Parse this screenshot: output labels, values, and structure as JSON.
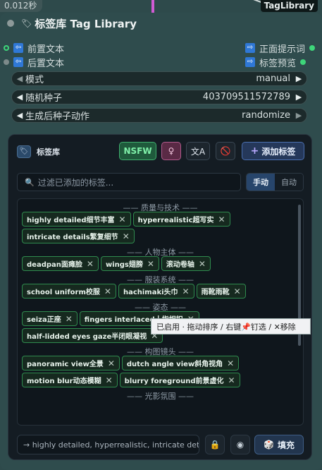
{
  "timer": "0.012秒",
  "top_tag": "TagLibrary",
  "node": {
    "title": "标签库 Tag Library"
  },
  "inputs": [
    {
      "label": "前置文本"
    },
    {
      "label": "后置文本"
    }
  ],
  "outputs": [
    {
      "label": "正面提示词"
    },
    {
      "label": "标签预览"
    }
  ],
  "widgets": [
    {
      "label": "模式",
      "value": "manual"
    },
    {
      "label": "随机种子",
      "value": "403709511572789"
    },
    {
      "label": "生成后种子动作",
      "value": "randomize"
    }
  ],
  "panel": {
    "title": "标签库",
    "nsfw_label": "NSFW",
    "gender_icon": "♀",
    "translate_label": "文A",
    "add_label": "添加标签",
    "search_placeholder": "过滤已添加的标签...",
    "mode_manual": "手动",
    "mode_auto": "自动",
    "categories": [
      {
        "name": "—— 质量与技术 ——",
        "tags": [
          "highly detailed细节丰富",
          "hyperrealistic超写实",
          "intricate details繁复细节"
        ]
      },
      {
        "name": "—— 人物主体 ——",
        "tags": [
          "deadpan面瘫脸",
          "wings翅膀",
          "滚动卷轴"
        ]
      },
      {
        "name": "—— 服装系统 ——",
        "tags": [
          "school uniform校服",
          "hachimaki头巾",
          "雨靴雨靴"
        ]
      },
      {
        "name": "—— 姿态 ——",
        "tags": [
          "seiza正座",
          "fingers interlaced十指相扣",
          "half-lidded eyes gaze半闭眼凝视"
        ]
      },
      {
        "name": "—— 构图镜头 ——",
        "tags": [
          "panoramic view全景",
          "dutch angle view斜角视角",
          "motion blur动态模糊",
          "blurry foreground前景虚化"
        ]
      },
      {
        "name": "—— 光影氛围 ——",
        "tags": []
      }
    ],
    "tooltip": "已启用 · 拖动排序 / 右键📌钉选 / ✕移除",
    "output_preview": "→ highly detailed, hyperrealistic, intricate deta...",
    "lock_icon": "🔒",
    "eye_icon": "◉",
    "fill_label": "填充"
  },
  "colors": {
    "accent_green": "#2f8a4e",
    "nsfw_bg": "#1f5a3c",
    "add_bg": "#25385a"
  }
}
